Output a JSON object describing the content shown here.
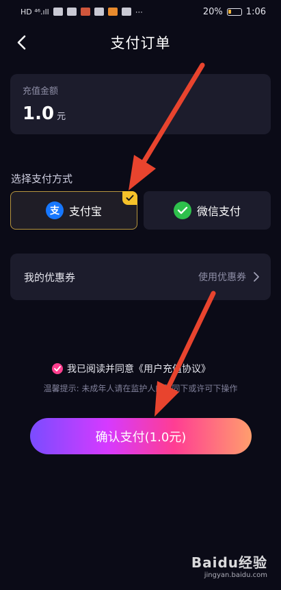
{
  "status_bar": {
    "left": "HD ⁴⁶.ıll",
    "battery": "20%",
    "time": "1:06"
  },
  "header": {
    "title": "支付订单"
  },
  "amount": {
    "label": "充值金额",
    "value": "1.0",
    "unit": "元"
  },
  "payment": {
    "section_label": "选择支付方式",
    "options": [
      {
        "label": "支付宝",
        "icon": "alipay-icon",
        "selected": true
      },
      {
        "label": "微信支付",
        "icon": "wechat-icon",
        "selected": false
      }
    ]
  },
  "coupon": {
    "title": "我的优惠券",
    "action": "使用优惠券"
  },
  "agreement": {
    "text": "我已阅读并同意《用户充值协议》"
  },
  "tip": {
    "text": "温馨提示: 未成年人请在监护人的陪同下或许可下操作"
  },
  "confirm": {
    "label": "确认支付(1.0元)"
  },
  "watermark": {
    "main": "Baidu经验",
    "sub": "jingyan.baidu.com"
  },
  "colors": {
    "accent": "#ff3f8f",
    "alipay": "#1677ff",
    "wechat": "#2ec04c",
    "badge": "#f6c22a",
    "arrow": "#e8442e"
  }
}
